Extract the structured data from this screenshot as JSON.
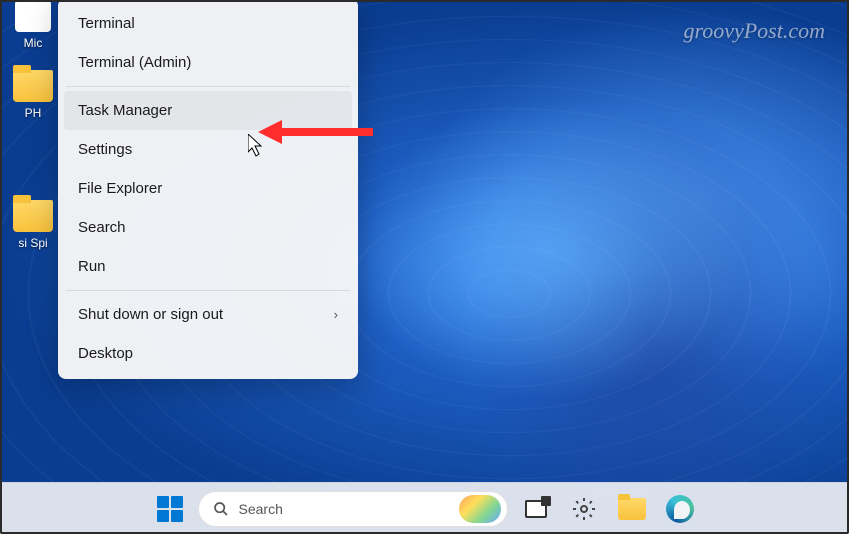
{
  "watermark": "groovyPost.com",
  "desktop_icons": [
    {
      "label": "Mic"
    },
    {
      "label": "PH"
    },
    {
      "label": "si   Spi"
    }
  ],
  "context_menu": {
    "items": [
      {
        "label": "Terminal",
        "has_submenu": false
      },
      {
        "label": "Terminal (Admin)",
        "has_submenu": false
      }
    ],
    "items2": [
      {
        "label": "Task Manager",
        "has_submenu": false,
        "hovered": true
      },
      {
        "label": "Settings",
        "has_submenu": false
      },
      {
        "label": "File Explorer",
        "has_submenu": false
      },
      {
        "label": "Search",
        "has_submenu": false
      },
      {
        "label": "Run",
        "has_submenu": false
      }
    ],
    "items3": [
      {
        "label": "Shut down or sign out",
        "has_submenu": true
      },
      {
        "label": "Desktop",
        "has_submenu": false
      }
    ]
  },
  "taskbar": {
    "search_placeholder": "Search"
  },
  "annotation": {
    "arrow_color": "#ff2d2d"
  }
}
